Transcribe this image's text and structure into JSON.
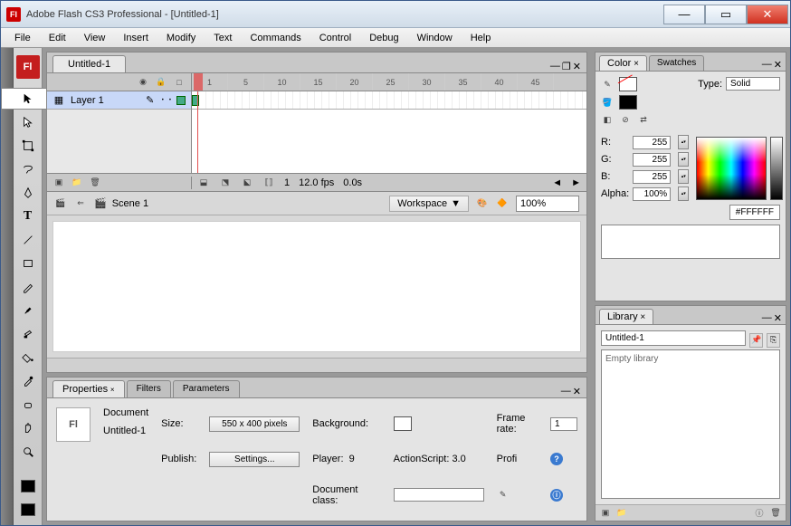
{
  "window": {
    "title": "Adobe Flash CS3 Professional - [Untitled-1]",
    "app_short": "Fl"
  },
  "menu": [
    "File",
    "Edit",
    "View",
    "Insert",
    "Modify",
    "Text",
    "Commands",
    "Control",
    "Debug",
    "Window",
    "Help"
  ],
  "doc": {
    "tab": "Untitled-1"
  },
  "timeline": {
    "layer_name": "Layer 1",
    "ticks": [
      "1",
      "5",
      "10",
      "15",
      "20",
      "25",
      "30",
      "35",
      "40",
      "45"
    ],
    "current_frame": "1",
    "fps": "12.0 fps",
    "time": "0.0s"
  },
  "stage": {
    "scene": "Scene 1",
    "workspace_label": "Workspace",
    "zoom": "100%"
  },
  "properties": {
    "tabs": [
      "Properties",
      "Filters",
      "Parameters"
    ],
    "doc_type": "Document",
    "doc_name": "Untitled-1",
    "size_label": "Size:",
    "size_value": "550 x 400 pixels",
    "bg_label": "Background:",
    "frame_rate_label": "Frame rate:",
    "frame_rate": "1",
    "publish_label": "Publish:",
    "settings_btn": "Settings...",
    "player_label": "Player:",
    "player": "9",
    "as_label": "ActionScript:",
    "as": "3.0",
    "profile_label": "Profi",
    "doc_class_label": "Document class:",
    "doc_class": ""
  },
  "color": {
    "tabs": [
      "Color",
      "Swatches"
    ],
    "type_label": "Type:",
    "type_value": "Solid",
    "r_label": "R:",
    "r": "255",
    "g_label": "G:",
    "g": "255",
    "b_label": "B:",
    "b": "255",
    "alpha_label": "Alpha:",
    "alpha": "100%",
    "hex": "#FFFFFF"
  },
  "library": {
    "tab": "Library",
    "selected": "Untitled-1",
    "empty": "Empty library"
  }
}
